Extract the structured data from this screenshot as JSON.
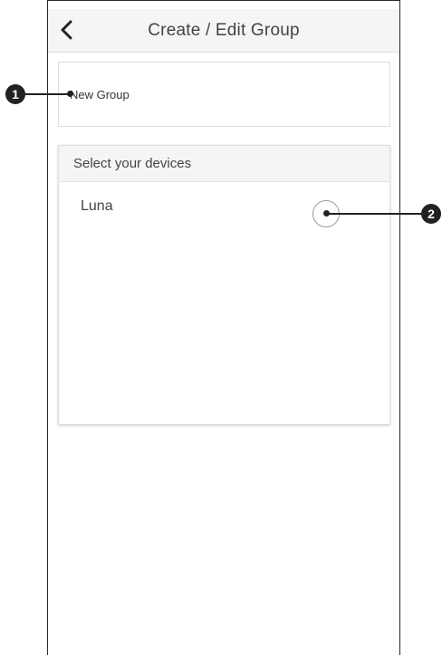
{
  "header": {
    "title": "Create / Edit Group",
    "back_icon": "chevron-left-icon"
  },
  "group_name": {
    "value": "New Group"
  },
  "devices": {
    "section_title": "Select your devices",
    "items": [
      {
        "name": "Luna",
        "selected": false
      }
    ]
  },
  "callouts": {
    "one": "1",
    "two": "2"
  }
}
